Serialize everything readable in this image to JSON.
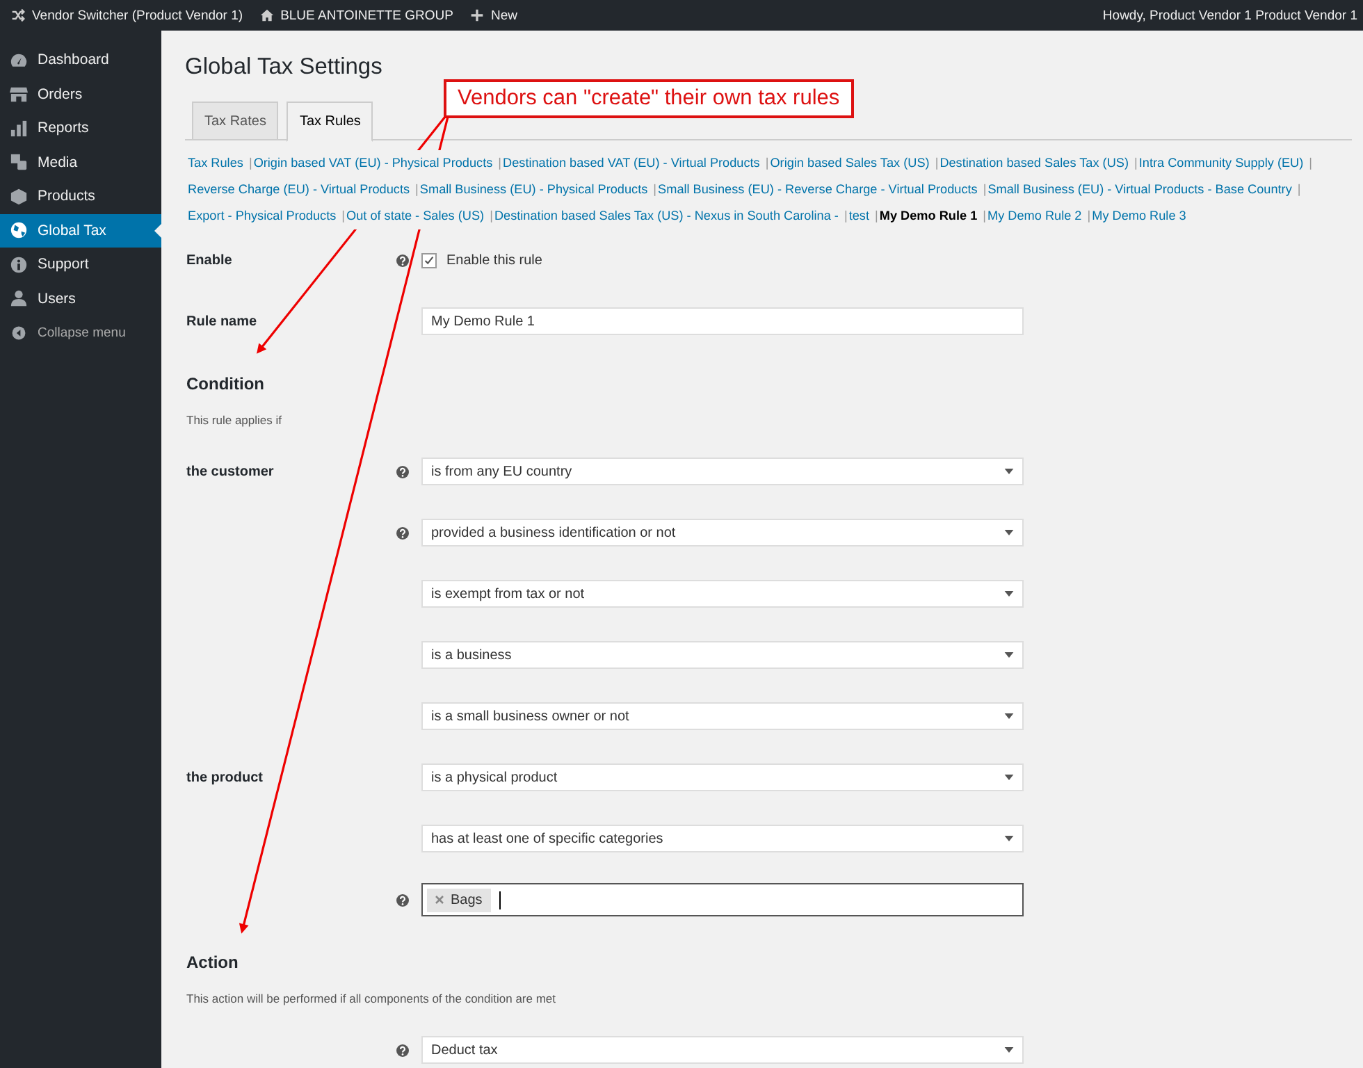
{
  "admin_bar": {
    "switcher": "Vendor Switcher (Product Vendor 1)",
    "site": "BLUE ANTOINETTE GROUP",
    "new": "New",
    "greeting": "Howdy, Product Vendor 1 Product Vendor 1"
  },
  "sidebar": {
    "items": [
      {
        "label": "Dashboard",
        "selected": false
      },
      {
        "label": "Orders",
        "selected": false
      },
      {
        "label": "Reports",
        "selected": false
      },
      {
        "label": "Media",
        "selected": false
      },
      {
        "label": "Products",
        "selected": false
      },
      {
        "label": "Global Tax",
        "selected": true
      },
      {
        "label": "Support",
        "selected": false
      },
      {
        "label": "Users",
        "selected": false
      }
    ],
    "collapse": "Collapse menu"
  },
  "page_title": "Global Tax Settings",
  "tabs": [
    {
      "label": "Tax Rates",
      "selected": false
    },
    {
      "label": "Tax Rules",
      "selected": true
    }
  ],
  "rule_links": {
    "separator": "|",
    "items": [
      {
        "label": "Tax Rules",
        "selected": false
      },
      {
        "label": "Origin based VAT (EU) - Physical Products",
        "selected": false
      },
      {
        "label": "Destination based VAT (EU) - Virtual Products",
        "selected": false
      },
      {
        "label": "Origin based Sales Tax (US)",
        "selected": false
      },
      {
        "label": "Destination based Sales Tax (US)",
        "selected": false
      },
      {
        "label": "Intra Community Supply (EU)",
        "selected": false
      },
      {
        "label": "Reverse Charge (EU) - Virtual Products",
        "selected": false
      },
      {
        "label": "Small Business (EU) - Physical Products",
        "selected": false
      },
      {
        "label": "Small Business (EU) - Reverse Charge - Virtual Products",
        "selected": false
      },
      {
        "label": "Small Business (EU) - Virtual Products - Base Country",
        "selected": false
      },
      {
        "label": "Export - Physical Products",
        "selected": false
      },
      {
        "label": "Out of state - Sales (US)",
        "selected": false
      },
      {
        "label": "Destination based Sales Tax (US) - Nexus in South Carolina -",
        "selected": false
      },
      {
        "label": "test",
        "selected": false
      },
      {
        "label": "My Demo Rule 1",
        "selected": true
      },
      {
        "label": "My Demo Rule 2",
        "selected": false
      },
      {
        "label": "My Demo Rule 3",
        "selected": false
      }
    ]
  },
  "rows": [
    {
      "kind": "checkbox",
      "label": "Enable",
      "help": true,
      "text": "Enable this rule",
      "checked": true
    },
    {
      "kind": "text",
      "label": "Rule name",
      "help": false,
      "value": "My Demo Rule 1"
    },
    {
      "kind": "heading",
      "label": "Condition"
    },
    {
      "kind": "note",
      "text": "This rule applies if"
    },
    {
      "kind": "select",
      "label": "the customer",
      "help": true,
      "value": "is from any EU country"
    },
    {
      "kind": "select",
      "help": true,
      "value": "provided a business identification or not"
    },
    {
      "kind": "select",
      "help": false,
      "value": "is exempt from tax or not"
    },
    {
      "kind": "select",
      "help": false,
      "value": "is a business"
    },
    {
      "kind": "select",
      "help": false,
      "value": "is a small business owner or not"
    },
    {
      "kind": "select",
      "label": "the product",
      "help": false,
      "value": "is a physical product"
    },
    {
      "kind": "select",
      "help": false,
      "value": "has at least one of specific categories"
    },
    {
      "kind": "tags",
      "help": true,
      "tags": [
        "Bags"
      ]
    },
    {
      "kind": "heading",
      "label": "Action"
    },
    {
      "kind": "note",
      "text": "This action will be performed if all components of the condition are met"
    },
    {
      "kind": "select",
      "help": true,
      "value": "Deduct tax"
    }
  ],
  "annotation": {
    "text": "Vendors can \"create\" their own tax rules"
  }
}
